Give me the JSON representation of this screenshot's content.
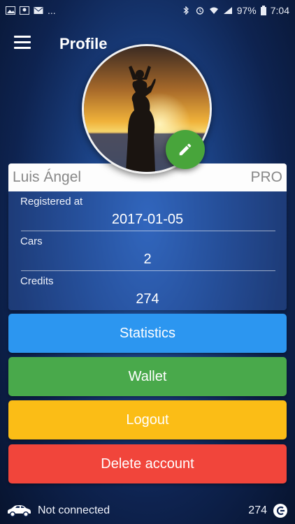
{
  "status_bar": {
    "overflow": "...",
    "battery": "97%",
    "time": "7:04",
    "left_icons": [
      "image-icon",
      "map-photo-icon",
      "mail-icon"
    ],
    "right_icons": [
      "bluetooth-icon",
      "alarm-icon",
      "wifi-icon",
      "signal-icon",
      "battery-icon"
    ]
  },
  "app_bar": {
    "title": "Profile",
    "menu_icon": "hamburger-menu-icon"
  },
  "profile": {
    "avatar_icon": "profile-photo",
    "edit_icon": "pencil-icon",
    "name": "Luis Ángel",
    "badge": "PRO"
  },
  "info": {
    "registered_label": "Registered at",
    "registered_value": "2017-01-05",
    "cars_label": "Cars",
    "cars_value": "2",
    "credits_label": "Credits",
    "credits_value": "274"
  },
  "buttons": {
    "statistics": "Statistics",
    "wallet": "Wallet",
    "logout": "Logout",
    "delete": "Delete account"
  },
  "colors": {
    "statistics": "#2c96f0",
    "wallet": "#49a94b",
    "logout": "#fbbd16",
    "delete": "#f1453b",
    "edit_fab": "#48a53b"
  },
  "bottom_bar": {
    "connection_status": "Not connected",
    "credits": "274",
    "car_icon": "car-icon",
    "credits_icon": "credit-coin-icon"
  }
}
